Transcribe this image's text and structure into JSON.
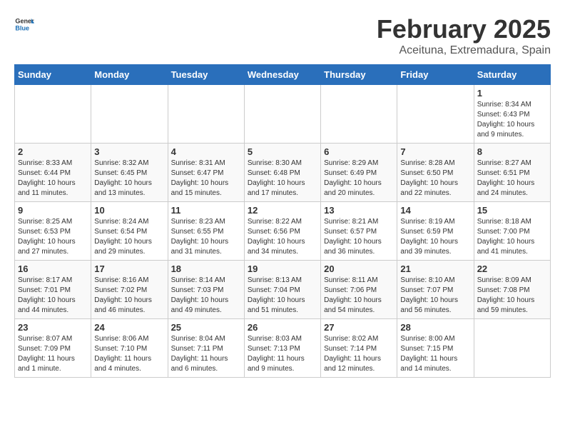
{
  "header": {
    "logo_general": "General",
    "logo_blue": "Blue",
    "title": "February 2025",
    "subtitle": "Aceituna, Extremadura, Spain"
  },
  "days_of_week": [
    "Sunday",
    "Monday",
    "Tuesday",
    "Wednesday",
    "Thursday",
    "Friday",
    "Saturday"
  ],
  "weeks": [
    [
      {
        "day": "",
        "info": ""
      },
      {
        "day": "",
        "info": ""
      },
      {
        "day": "",
        "info": ""
      },
      {
        "day": "",
        "info": ""
      },
      {
        "day": "",
        "info": ""
      },
      {
        "day": "",
        "info": ""
      },
      {
        "day": "1",
        "info": "Sunrise: 8:34 AM\nSunset: 6:43 PM\nDaylight: 10 hours and 9 minutes."
      }
    ],
    [
      {
        "day": "2",
        "info": "Sunrise: 8:33 AM\nSunset: 6:44 PM\nDaylight: 10 hours and 11 minutes."
      },
      {
        "day": "3",
        "info": "Sunrise: 8:32 AM\nSunset: 6:45 PM\nDaylight: 10 hours and 13 minutes."
      },
      {
        "day": "4",
        "info": "Sunrise: 8:31 AM\nSunset: 6:47 PM\nDaylight: 10 hours and 15 minutes."
      },
      {
        "day": "5",
        "info": "Sunrise: 8:30 AM\nSunset: 6:48 PM\nDaylight: 10 hours and 17 minutes."
      },
      {
        "day": "6",
        "info": "Sunrise: 8:29 AM\nSunset: 6:49 PM\nDaylight: 10 hours and 20 minutes."
      },
      {
        "day": "7",
        "info": "Sunrise: 8:28 AM\nSunset: 6:50 PM\nDaylight: 10 hours and 22 minutes."
      },
      {
        "day": "8",
        "info": "Sunrise: 8:27 AM\nSunset: 6:51 PM\nDaylight: 10 hours and 24 minutes."
      }
    ],
    [
      {
        "day": "9",
        "info": "Sunrise: 8:25 AM\nSunset: 6:53 PM\nDaylight: 10 hours and 27 minutes."
      },
      {
        "day": "10",
        "info": "Sunrise: 8:24 AM\nSunset: 6:54 PM\nDaylight: 10 hours and 29 minutes."
      },
      {
        "day": "11",
        "info": "Sunrise: 8:23 AM\nSunset: 6:55 PM\nDaylight: 10 hours and 31 minutes."
      },
      {
        "day": "12",
        "info": "Sunrise: 8:22 AM\nSunset: 6:56 PM\nDaylight: 10 hours and 34 minutes."
      },
      {
        "day": "13",
        "info": "Sunrise: 8:21 AM\nSunset: 6:57 PM\nDaylight: 10 hours and 36 minutes."
      },
      {
        "day": "14",
        "info": "Sunrise: 8:19 AM\nSunset: 6:59 PM\nDaylight: 10 hours and 39 minutes."
      },
      {
        "day": "15",
        "info": "Sunrise: 8:18 AM\nSunset: 7:00 PM\nDaylight: 10 hours and 41 minutes."
      }
    ],
    [
      {
        "day": "16",
        "info": "Sunrise: 8:17 AM\nSunset: 7:01 PM\nDaylight: 10 hours and 44 minutes."
      },
      {
        "day": "17",
        "info": "Sunrise: 8:16 AM\nSunset: 7:02 PM\nDaylight: 10 hours and 46 minutes."
      },
      {
        "day": "18",
        "info": "Sunrise: 8:14 AM\nSunset: 7:03 PM\nDaylight: 10 hours and 49 minutes."
      },
      {
        "day": "19",
        "info": "Sunrise: 8:13 AM\nSunset: 7:04 PM\nDaylight: 10 hours and 51 minutes."
      },
      {
        "day": "20",
        "info": "Sunrise: 8:11 AM\nSunset: 7:06 PM\nDaylight: 10 hours and 54 minutes."
      },
      {
        "day": "21",
        "info": "Sunrise: 8:10 AM\nSunset: 7:07 PM\nDaylight: 10 hours and 56 minutes."
      },
      {
        "day": "22",
        "info": "Sunrise: 8:09 AM\nSunset: 7:08 PM\nDaylight: 10 hours and 59 minutes."
      }
    ],
    [
      {
        "day": "23",
        "info": "Sunrise: 8:07 AM\nSunset: 7:09 PM\nDaylight: 11 hours and 1 minute."
      },
      {
        "day": "24",
        "info": "Sunrise: 8:06 AM\nSunset: 7:10 PM\nDaylight: 11 hours and 4 minutes."
      },
      {
        "day": "25",
        "info": "Sunrise: 8:04 AM\nSunset: 7:11 PM\nDaylight: 11 hours and 6 minutes."
      },
      {
        "day": "26",
        "info": "Sunrise: 8:03 AM\nSunset: 7:13 PM\nDaylight: 11 hours and 9 minutes."
      },
      {
        "day": "27",
        "info": "Sunrise: 8:02 AM\nSunset: 7:14 PM\nDaylight: 11 hours and 12 minutes."
      },
      {
        "day": "28",
        "info": "Sunrise: 8:00 AM\nSunset: 7:15 PM\nDaylight: 11 hours and 14 minutes."
      },
      {
        "day": "",
        "info": ""
      }
    ]
  ]
}
